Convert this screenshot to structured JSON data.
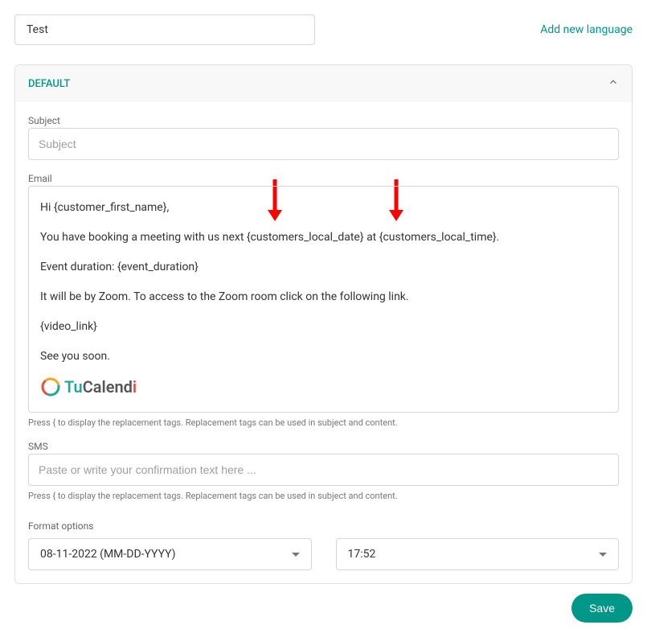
{
  "header": {
    "test_value": "Test",
    "add_language": "Add new language"
  },
  "panel": {
    "title": "DEFAULT",
    "subject": {
      "label": "Subject",
      "placeholder": "Subject",
      "value": ""
    },
    "email": {
      "label": "Email",
      "line1": "Hi  {customer_first_name},",
      "line2": "You have booking a meeting with us next {customers_local_date} at {customers_local_time}.",
      "line3": "Event duration: {event_duration}",
      "line4": "It will be by Zoom. To access to the Zoom room click on the following link.",
      "line5": "{video_link}",
      "line6": "See you soon.",
      "helper": "Press { to display the replacement tags. Replacement tags can be used in subject and content.",
      "logo_tu": "Tu",
      "logo_calend": "Calend",
      "logo_i": "i"
    },
    "sms": {
      "label": "SMS",
      "placeholder": "Paste or write your confirmation text here ...",
      "value": "",
      "helper": "Press { to display the replacement tags. Replacement tags can be used in subject and content."
    },
    "format": {
      "label": "Format options",
      "date_value": "08-11-2022 (MM-DD-YYYY)",
      "time_value": "17:52"
    }
  },
  "footer": {
    "save": "Save"
  }
}
